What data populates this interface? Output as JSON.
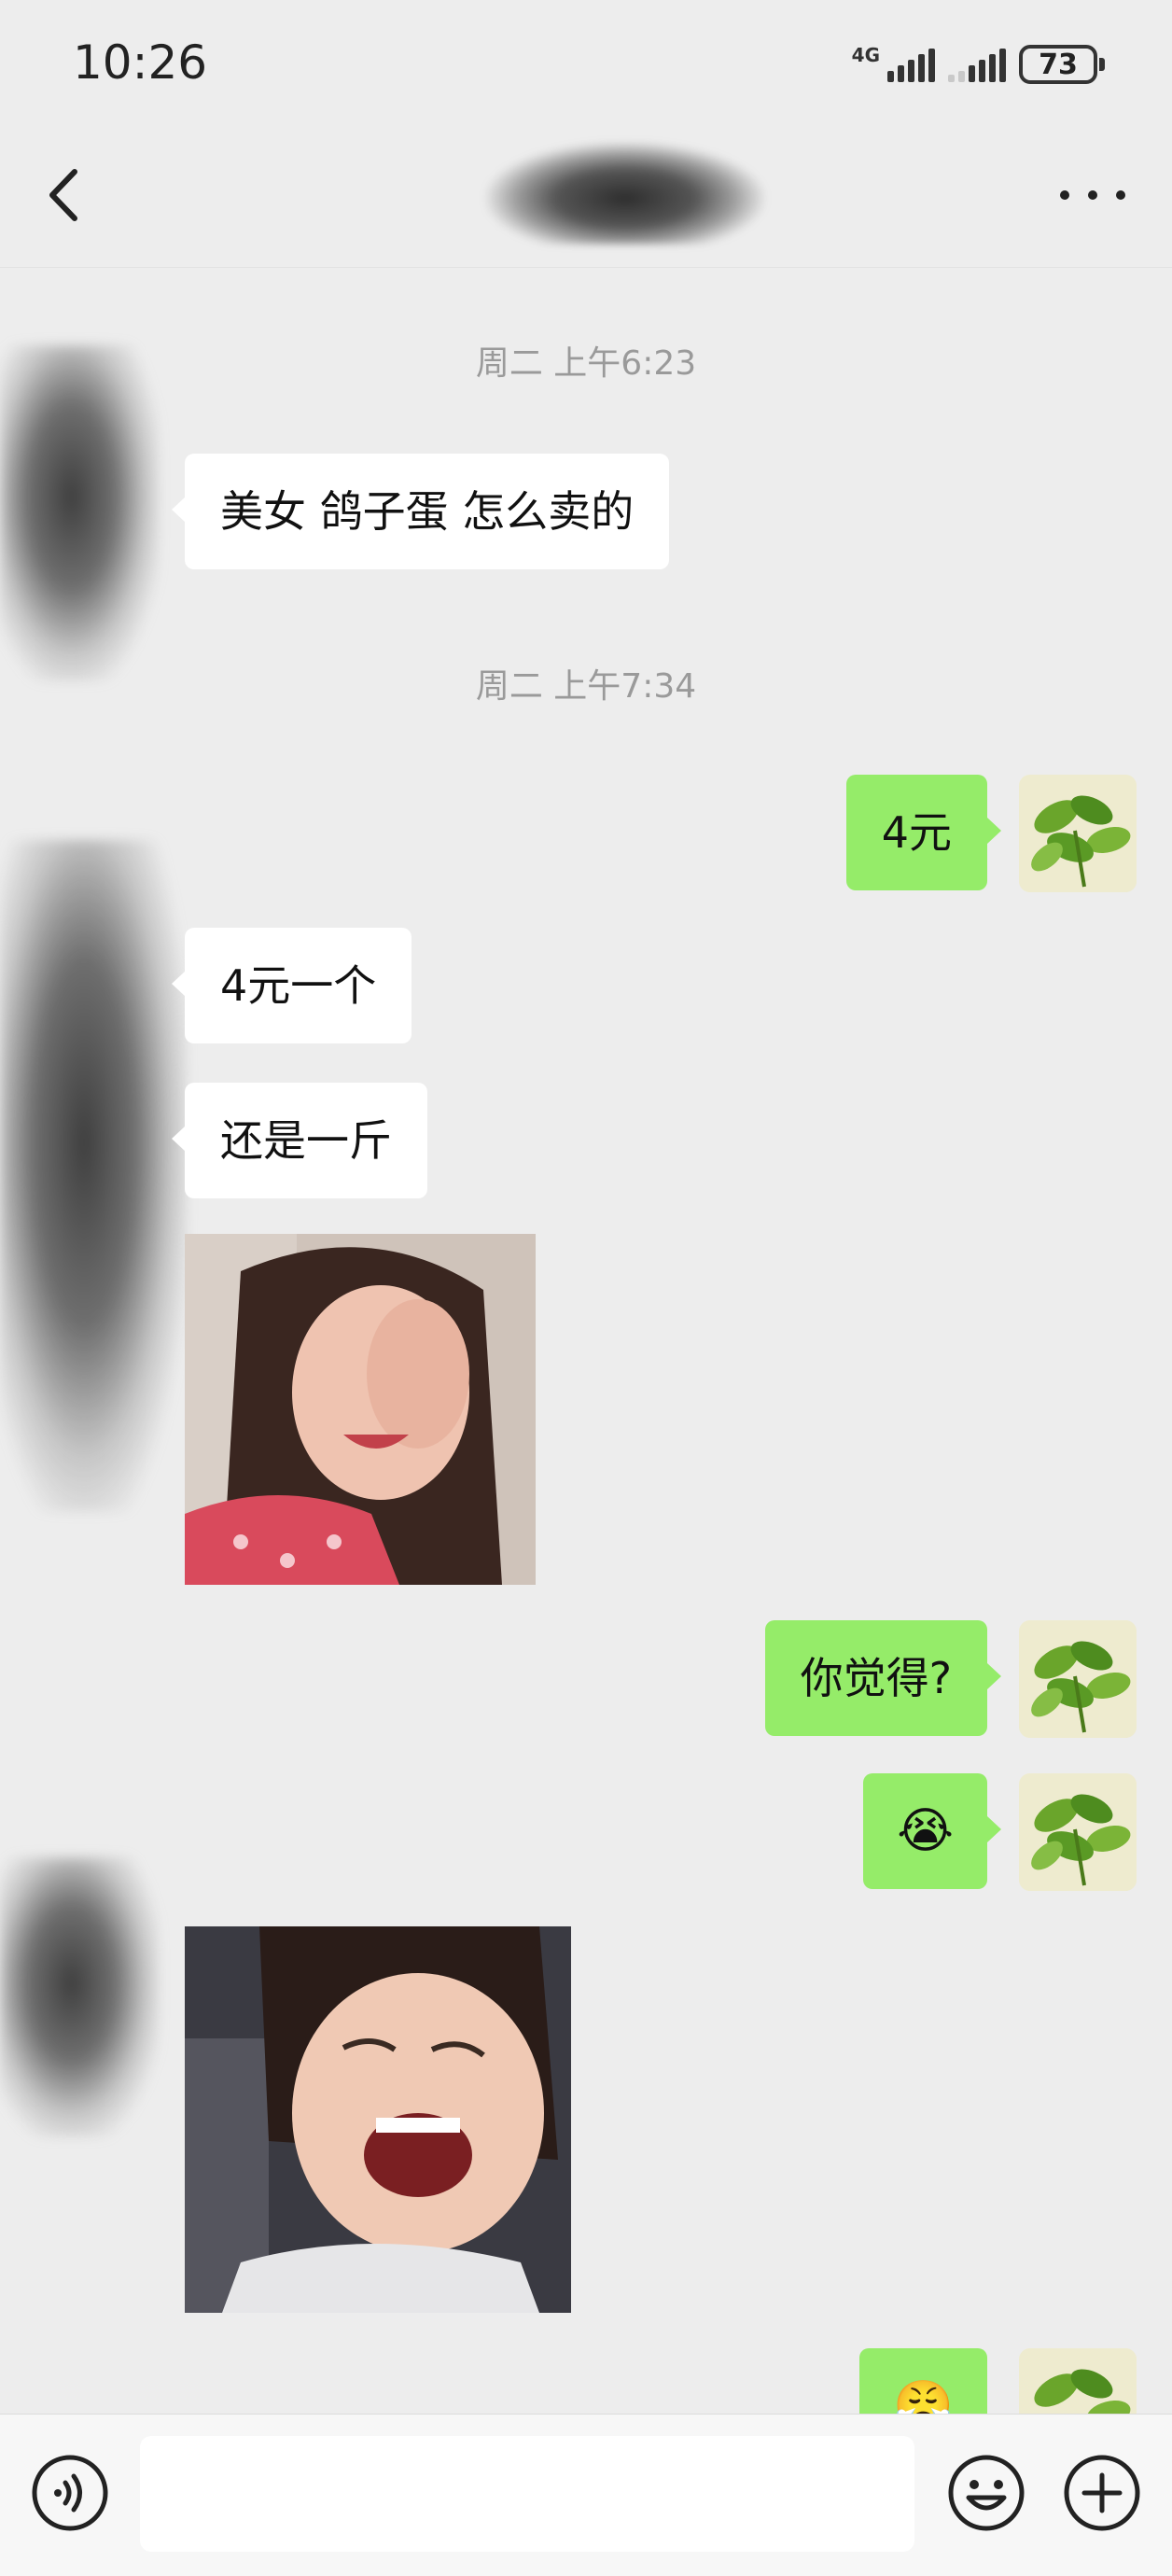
{
  "status_bar": {
    "time": "10:26",
    "network_label": "4G",
    "battery": "73"
  },
  "nav": {
    "contact_name": "",
    "back_icon": "chevron-left-icon",
    "more_icon": "more-dots-icon"
  },
  "messages": {
    "timestamp_1": "周二 上午6:23",
    "msg_1": "美女 鸽子蛋 怎么卖的",
    "timestamp_2": "周二 上午7:34",
    "msg_2": "4元",
    "msg_3": "4元一个",
    "msg_4": "还是一斤",
    "msg_5": "你觉得?",
    "msg_6_emoji": "😭",
    "msg_7_emoji": "😤"
  },
  "input_bar": {
    "placeholder": "",
    "voice_icon": "voice-icon",
    "emoji_icon": "emoji-icon",
    "plus_icon": "plus-icon"
  },
  "colors": {
    "background": "#ededed",
    "outgoing_bubble": "#95ec69",
    "incoming_bubble": "#ffffff",
    "timestamp_text": "#9a9a9a"
  }
}
